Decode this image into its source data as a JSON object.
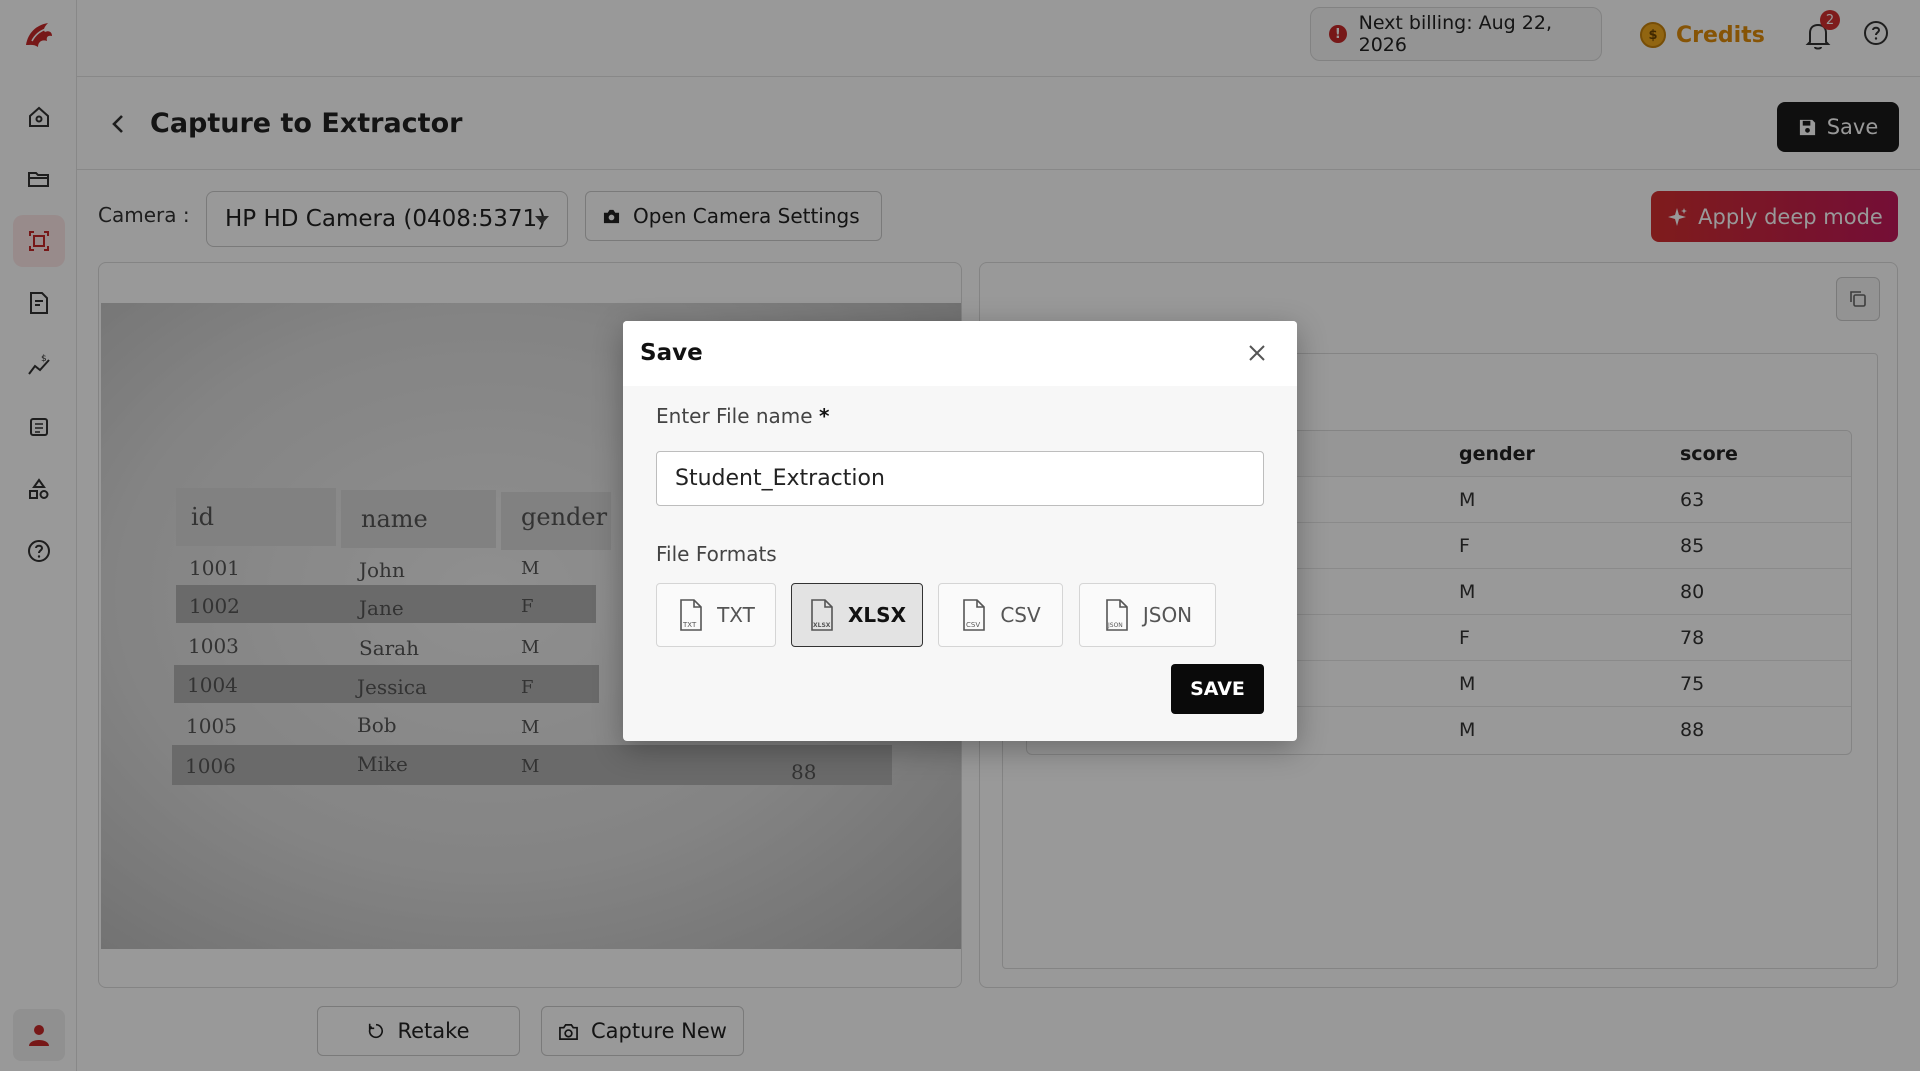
{
  "header": {
    "billing_text": "Next billing: Aug 22, 2026",
    "credits_label": "Credits",
    "notification_count": "2"
  },
  "page": {
    "title": "Capture to Extractor",
    "save_label": "Save"
  },
  "camera": {
    "label": "Camera :",
    "selected": "HP HD Camera (0408:5371)",
    "settings_label": "Open Camera Settings"
  },
  "deep_mode_label": "Apply deep mode",
  "photo_table": {
    "headers": [
      "id",
      "name",
      "gender"
    ],
    "rows": [
      [
        "1001",
        "John",
        "M",
        ""
      ],
      [
        "1002",
        "Jane",
        "F",
        ""
      ],
      [
        "1003",
        "Sarah",
        "M",
        ""
      ],
      [
        "1004",
        "Jessica",
        "F",
        ""
      ],
      [
        "1005",
        "Bob",
        "M",
        ""
      ],
      [
        "1006",
        "Mike",
        "M",
        "88"
      ]
    ]
  },
  "result_table": {
    "headers": [
      "gender",
      "score"
    ],
    "rows": [
      [
        "M",
        "63"
      ],
      [
        "F",
        "85"
      ],
      [
        "M",
        "80"
      ],
      [
        "F",
        "78"
      ],
      [
        "M",
        "75"
      ],
      [
        "M",
        "88"
      ]
    ]
  },
  "bottom": {
    "retake_label": "Retake",
    "capture_new_label": "Capture New"
  },
  "modal": {
    "title": "Save",
    "file_name_label": "Enter File name",
    "required_mark": "*",
    "file_name_value": "Student_Extraction",
    "file_formats_label": "File Formats",
    "formats": [
      {
        "label": "TXT",
        "icon_text": "TXT",
        "selected": false
      },
      {
        "label": "XLSX",
        "icon_text": "XLSX",
        "selected": true
      },
      {
        "label": "CSV",
        "icon_text": "CSV",
        "selected": false
      },
      {
        "label": "JSON",
        "icon_text": "JSON",
        "selected": false
      }
    ],
    "save_button_label": "SAVE"
  },
  "colors": {
    "accent_red": "#d32f2f",
    "credits_orange": "#e08c0b",
    "dark_button": "#1a1a1a"
  }
}
